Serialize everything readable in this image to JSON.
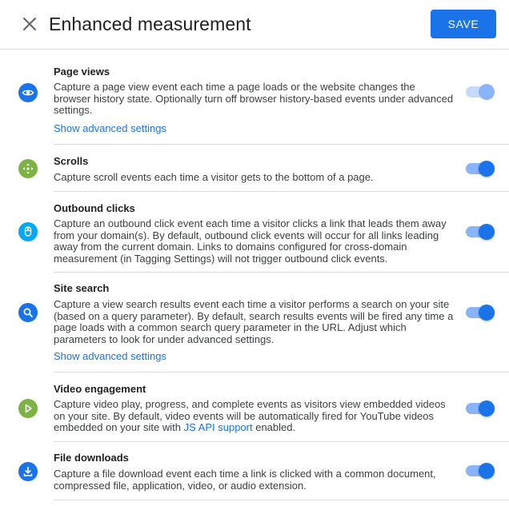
{
  "header": {
    "title": "Enhanced measurement",
    "save_label": "SAVE",
    "close_icon": "close-icon"
  },
  "colors": {
    "accent": "#1a73e8",
    "icon_blue": "#1a73e8",
    "icon_green": "#7cb342",
    "icon_cyan": "#03a9f4"
  },
  "sections": [
    {
      "title": "Page views",
      "description": "Capture a page view event each time a page loads or the website changes the browser history state. Optionally turn off browser history-based events under advanced settings.",
      "link": "Show advanced settings",
      "icon": "eye-icon",
      "enabled": true
    },
    {
      "title": "Scrolls",
      "description": "Capture scroll events each time a visitor gets to the bottom of a page.",
      "icon": "scroll-arrows-icon",
      "enabled": true
    },
    {
      "title": "Outbound clicks",
      "description": "Capture an outbound click event each time a visitor clicks a link that leads them away from your domain(s). By default, outbound click events will occur for all links leading away from the current domain. Links to domains configured for cross-domain measurement (in Tagging Settings) will not trigger outbound click events.",
      "icon": "mouse-icon",
      "enabled": true
    },
    {
      "title": "Site search",
      "description": "Capture a view search results event each time a visitor performs a search on your site (based on a query parameter). By default, search results events will be fired any time a page loads with a common search query parameter in the URL. Adjust which parameters to look for under advanced settings.",
      "link": "Show advanced settings",
      "icon": "search-icon",
      "enabled": true
    },
    {
      "title": "Video engagement",
      "description_before": "Capture video play, progress, and complete events as visitors view embedded videos on your site. By default, video events will be automatically fired for YouTube videos embedded on your site with ",
      "description_link": "JS API support",
      "description_after": " enabled.",
      "icon": "play-icon",
      "enabled": true
    },
    {
      "title": "File downloads",
      "description": "Capture a file download event each time a link is clicked with a common document, compressed file, application, video, or audio extension.",
      "icon": "download-icon",
      "enabled": true
    }
  ]
}
